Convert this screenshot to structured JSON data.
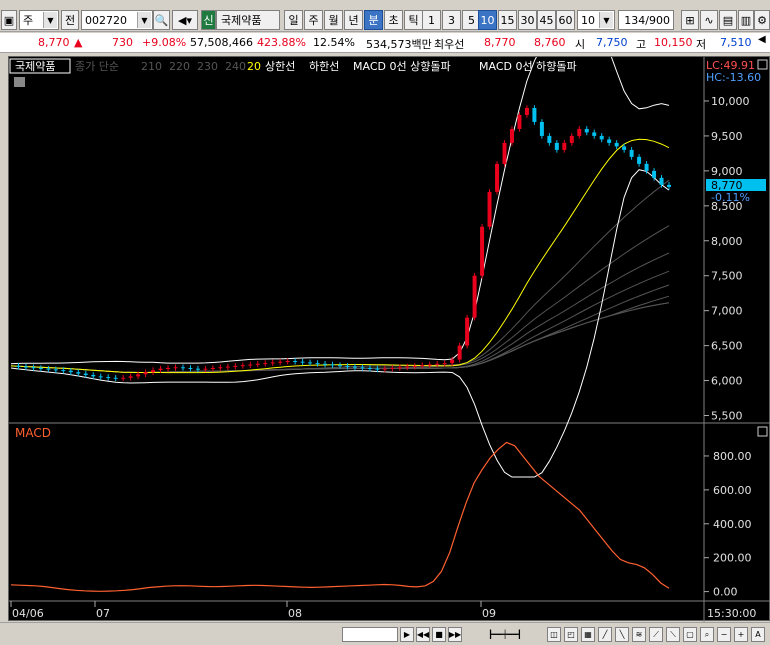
{
  "toolbar": {
    "market": "주",
    "prev": "전",
    "code": "002720",
    "credit": "신",
    "name": "국제약품",
    "periods": [
      "일",
      "주",
      "월",
      "년"
    ],
    "intervals_kind": [
      "분",
      "초",
      "틱"
    ],
    "active_kind": "분",
    "intervals": [
      "1",
      "3",
      "5",
      "10",
      "15",
      "30",
      "45",
      "60"
    ],
    "active_interval": "10",
    "count_select": "10",
    "count_display": "134",
    "count_total": "/900"
  },
  "quote": {
    "price": "8,770",
    "change": "730",
    "change_pct": "+9.08%",
    "volume": "57,508,466",
    "vol_ratio": "423.88%",
    "turnover": "12.54%",
    "amount": "534,573백만",
    "best_label": "최우선",
    "ask": "8,770",
    "bid": "8,760",
    "open_label": "시",
    "open": "7,750",
    "high_label": "고",
    "high": "10,150",
    "low_label": "저",
    "low": "7,510"
  },
  "legend": {
    "name": "국제약품",
    "ma": "종가 단순",
    "ma1": "210",
    "ma2": "220",
    "ma3": "230",
    "ma4": "240",
    "ma5": "20",
    "upper": "상한선",
    "lower": "하한선",
    "macd_up": "MACD 0선 상향돌파",
    "macd_down": "MACD 0선 하향돌파"
  },
  "price_panel": {
    "lc": "LC:49.91",
    "hc": "HC:-13.60",
    "current": "8,770",
    "current_pct": "-0.11%",
    "yticks": [
      "10,000",
      "9,500",
      "9,000",
      "8,500",
      "8,000",
      "7,500",
      "7,000",
      "6,500",
      "6,000",
      "5,500"
    ]
  },
  "macd_panel": {
    "title": "MACD",
    "yticks": [
      "800.00",
      "600.00",
      "400.00",
      "200.00",
      "0.00"
    ]
  },
  "xaxis": {
    "labels": [
      "04/06",
      "07",
      "08",
      "09"
    ],
    "time": "15:30:00"
  },
  "colors": {
    "up": "#e8001c",
    "down": "#00c0f0",
    "ma20": "#ffff00",
    "band": "#ffffff",
    "macd": "#ff6030"
  },
  "chart_data": {
    "type": "candlestick",
    "price_range": [
      5450,
      10200
    ],
    "closes": [
      6210,
      6200,
      6190,
      6180,
      6170,
      6160,
      6150,
      6140,
      6120,
      6100,
      6080,
      6060,
      6050,
      6040,
      6030,
      6040,
      6060,
      6090,
      6120,
      6150,
      6170,
      6180,
      6190,
      6180,
      6170,
      6160,
      6170,
      6180,
      6190,
      6200,
      6210,
      6220,
      6230,
      6240,
      6250,
      6260,
      6270,
      6280,
      6270,
      6260,
      6250,
      6240,
      6230,
      6220,
      6210,
      6200,
      6190,
      6180,
      6170,
      6160,
      6170,
      6180,
      6190,
      6200,
      6210,
      6220,
      6230,
      6240,
      6250,
      6300,
      6500,
      6900,
      7500,
      8200,
      8700,
      9100,
      9400,
      9600,
      9800,
      9900,
      9700,
      9500,
      9400,
      9300,
      9400,
      9500,
      9600,
      9550,
      9500,
      9450,
      9400,
      9350,
      9300,
      9200,
      9100,
      9000,
      8900,
      8800,
      8770
    ],
    "macd": [
      40,
      38,
      36,
      34,
      30,
      24,
      18,
      12,
      8,
      5,
      3,
      2,
      3,
      5,
      8,
      12,
      18,
      24,
      28,
      32,
      34,
      35,
      34,
      32,
      30,
      29,
      30,
      32,
      34,
      36,
      37,
      36,
      34,
      32,
      30,
      28,
      26,
      25,
      26,
      28,
      30,
      32,
      34,
      36,
      38,
      40,
      42,
      40,
      36,
      30,
      28,
      34,
      60,
      120,
      230,
      380,
      520,
      640,
      720,
      790,
      840,
      880,
      860,
      800,
      740,
      680,
      640,
      600,
      560,
      520,
      480,
      420,
      360,
      300,
      240,
      190,
      170,
      160,
      140,
      100,
      50,
      20
    ]
  }
}
